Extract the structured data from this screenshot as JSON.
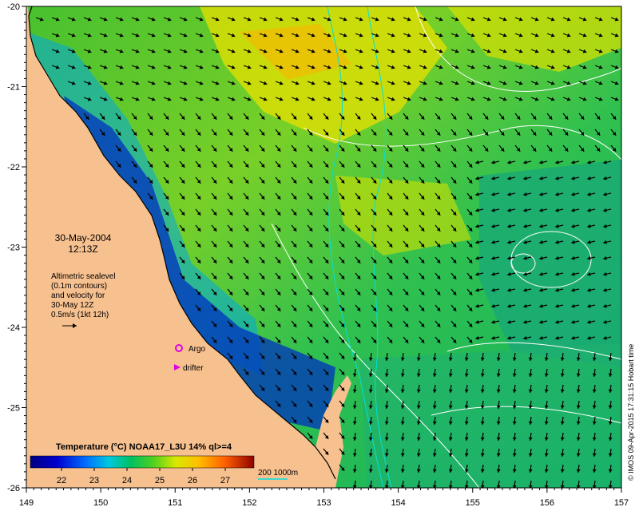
{
  "map": {
    "date_line": "30-May-2004",
    "time_line": "12:13Z",
    "legend_lines": [
      "Altimetric sealevel",
      "(0.1m contours)",
      "and velocity for",
      "30-May 12Z",
      "0.5m/s (1kt 12h)"
    ],
    "argo_label": "Argo",
    "drifter_label": "drifter",
    "colorbar_title": "Temperature (°C) NOAA17_L3U 14% ql>=4",
    "colorbar_ticks": [
      "22",
      "23",
      "24",
      "25",
      "26",
      "27"
    ],
    "depth_label": "200  1000m",
    "credit": "© IMOS 09-Apr-2015 17:31:15 Hobart time",
    "x_ticks": [
      "149",
      "150",
      "151",
      "152",
      "153",
      "154",
      "155",
      "156",
      "157"
    ],
    "y_ticks": [
      "-20",
      "-21",
      "-22",
      "-23",
      "-24",
      "-25",
      "-26"
    ],
    "colors": {
      "land": "#f7c08f",
      "argo": "#e000e0",
      "drifter": "#e000e0",
      "depth_contour": "#00e0e0"
    },
    "colorbar_colors": [
      "#000080",
      "#0000c8",
      "#0050ff",
      "#00a0ff",
      "#00d8d0",
      "#00c870",
      "#30d020",
      "#a0e000",
      "#f0f000",
      "#ffc000",
      "#ff7000",
      "#e02000",
      "#900000"
    ]
  }
}
